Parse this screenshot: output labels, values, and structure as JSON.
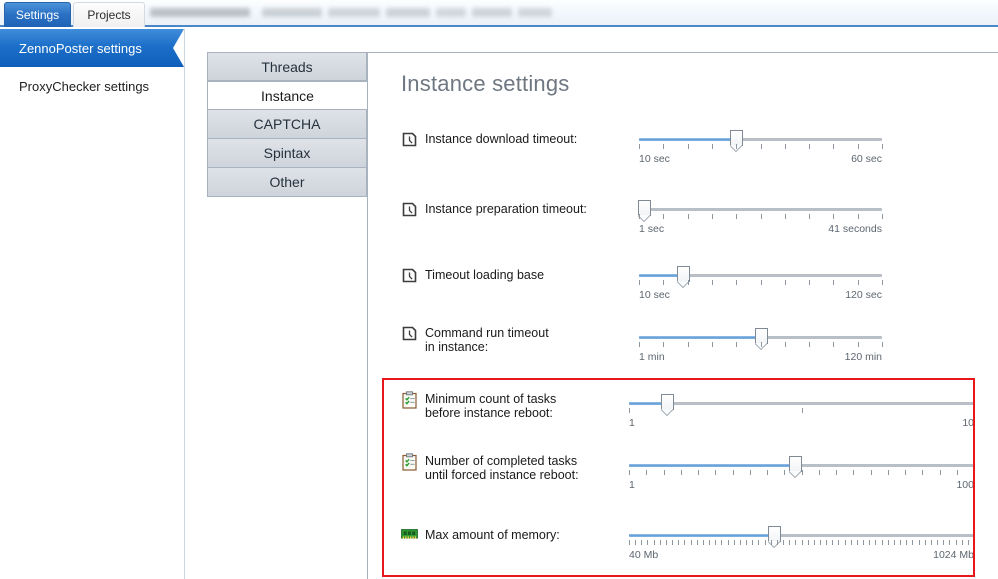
{
  "window": {
    "tabs": [
      {
        "label": "Settings",
        "active": true
      },
      {
        "label": "Projects",
        "active": false
      }
    ]
  },
  "sidebar": {
    "items": [
      {
        "label": "ZennoPoster settings",
        "active": true
      },
      {
        "label": "ProxyChecker settings",
        "active": false
      }
    ]
  },
  "categories": [
    {
      "label": "Threads",
      "selected": false
    },
    {
      "label": "Instance",
      "selected": true
    },
    {
      "label": "CAPTCHA",
      "selected": false
    },
    {
      "label": "Spintax",
      "selected": false
    },
    {
      "label": "Other",
      "selected": false
    }
  ],
  "panel": {
    "title": "Instance settings",
    "rows": [
      {
        "label": "Instance download timeout:",
        "icon": "clock-icon",
        "slider": {
          "min_label": "10 sec",
          "max_label": "60 sec",
          "value_pct": 40,
          "ticks": 11,
          "width": "narrow"
        }
      },
      {
        "label": "Instance preparation timeout:",
        "icon": "clock-icon",
        "slider": {
          "min_label": "1 sec",
          "max_label": "41 seconds",
          "value_pct": 2,
          "ticks": 11,
          "width": "narrow"
        }
      },
      {
        "label": "Timeout loading base",
        "icon": "clock-icon",
        "slider": {
          "min_label": "10 sec",
          "max_label": "120 sec",
          "value_pct": 18,
          "ticks": 11,
          "width": "narrow"
        }
      },
      {
        "label": "Command run timeout\nin instance:",
        "icon": "clock-icon",
        "slider": {
          "min_label": "1 min",
          "max_label": "120 min",
          "value_pct": 50,
          "ticks": 11,
          "width": "narrow"
        }
      },
      {
        "label": "Minimum count of tasks\nbefore instance reboot:",
        "icon": "task-list-icon",
        "slider": {
          "min_label": "1",
          "max_label": "10",
          "value_pct": 11,
          "ticks": 2,
          "width": "wide"
        }
      },
      {
        "label": "Number of completed tasks\nuntil forced instance reboot:",
        "icon": "task-list-icon",
        "slider": {
          "min_label": "1",
          "max_label": "100",
          "value_pct": 48,
          "ticks": 21,
          "width": "wide"
        }
      },
      {
        "label": "Max amount of memory:",
        "icon": "memory-icon",
        "slider": {
          "min_label": "40 Mb",
          "max_label": "1024 Mb",
          "value_pct": 42,
          "ticks": 57,
          "width": "wide"
        }
      }
    ]
  },
  "highlight": {
    "color": "#e8171b"
  },
  "theme": {
    "accent": "#1c6fc9",
    "tab_active": "#2a71c4",
    "slider_fill": "#5e9bd6"
  }
}
